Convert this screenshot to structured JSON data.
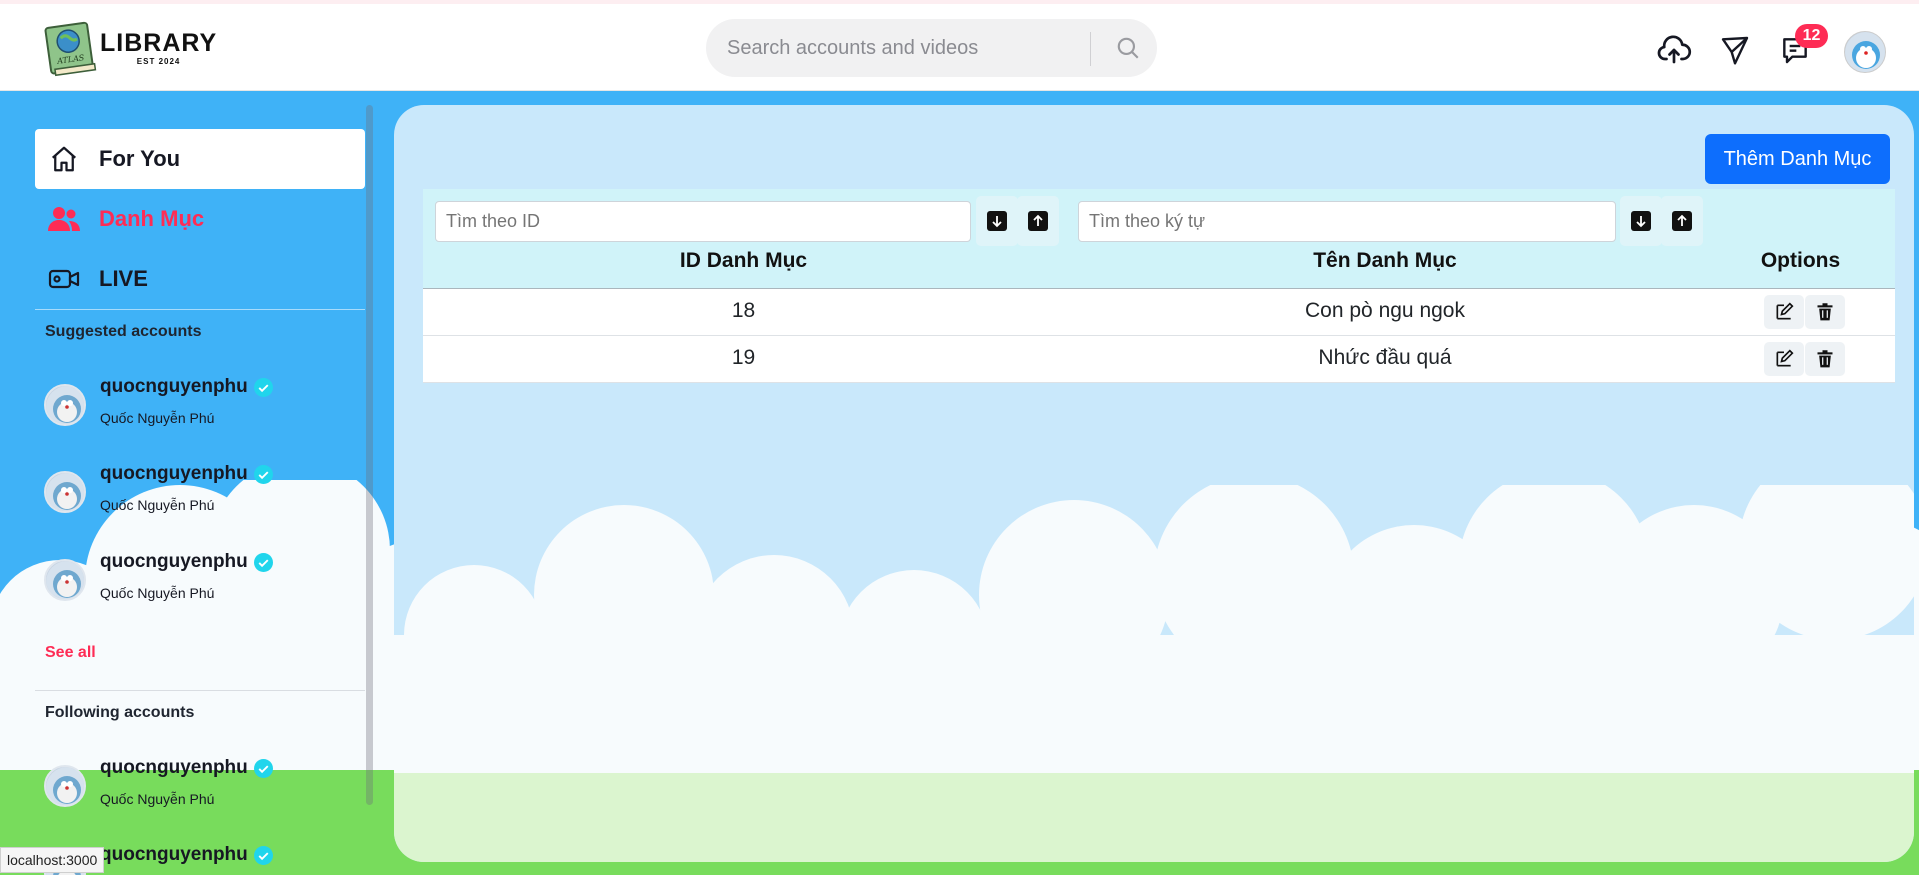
{
  "logo": {
    "main": "LIBRARY",
    "sub": "EST 2024",
    "book_text": "ATLAS"
  },
  "search": {
    "placeholder": "Search accounts and videos"
  },
  "header": {
    "notifications_count": "12"
  },
  "sidebar": {
    "nav": [
      {
        "label": "For You",
        "icon": "home-icon",
        "active": true
      },
      {
        "label": "Danh Mục",
        "icon": "users-icon",
        "active": false,
        "color": "#fe2c55"
      },
      {
        "label": "LIVE",
        "icon": "live-camera-icon",
        "active": false
      }
    ],
    "suggested_title": "Suggested accounts",
    "suggested": [
      {
        "username": "quocnguyenphu",
        "name": "Quốc Nguyễn Phú"
      },
      {
        "username": "quocnguyenphu",
        "name": "Quốc Nguyễn Phú"
      },
      {
        "username": "quocnguyenphu",
        "name": "Quốc Nguyễn Phú"
      }
    ],
    "see_all": "See all",
    "following_title": "Following accounts",
    "following": [
      {
        "username": "quocnguyenphu",
        "name": "Quốc Nguyễn Phú"
      },
      {
        "username": "quocnguyenphu",
        "name": ""
      }
    ]
  },
  "main": {
    "add_button": "Thêm Danh Mục",
    "filter_id_placeholder": "Tìm theo ID",
    "filter_name_placeholder": "Tìm theo ký tự",
    "columns": [
      "ID Danh Mục",
      "Tên Danh Mục",
      "Options"
    ],
    "rows": [
      {
        "id": "18",
        "name": "Con pò ngu ngok"
      },
      {
        "id": "19",
        "name": "Nhức đầu quá"
      }
    ]
  },
  "status_bar": {
    "url": "localhost:3000"
  },
  "colors": {
    "accent": "#fe2c55",
    "primary_button": "#0d6efd",
    "sky": "#3fb2f7",
    "grass": "#78dc5c"
  }
}
